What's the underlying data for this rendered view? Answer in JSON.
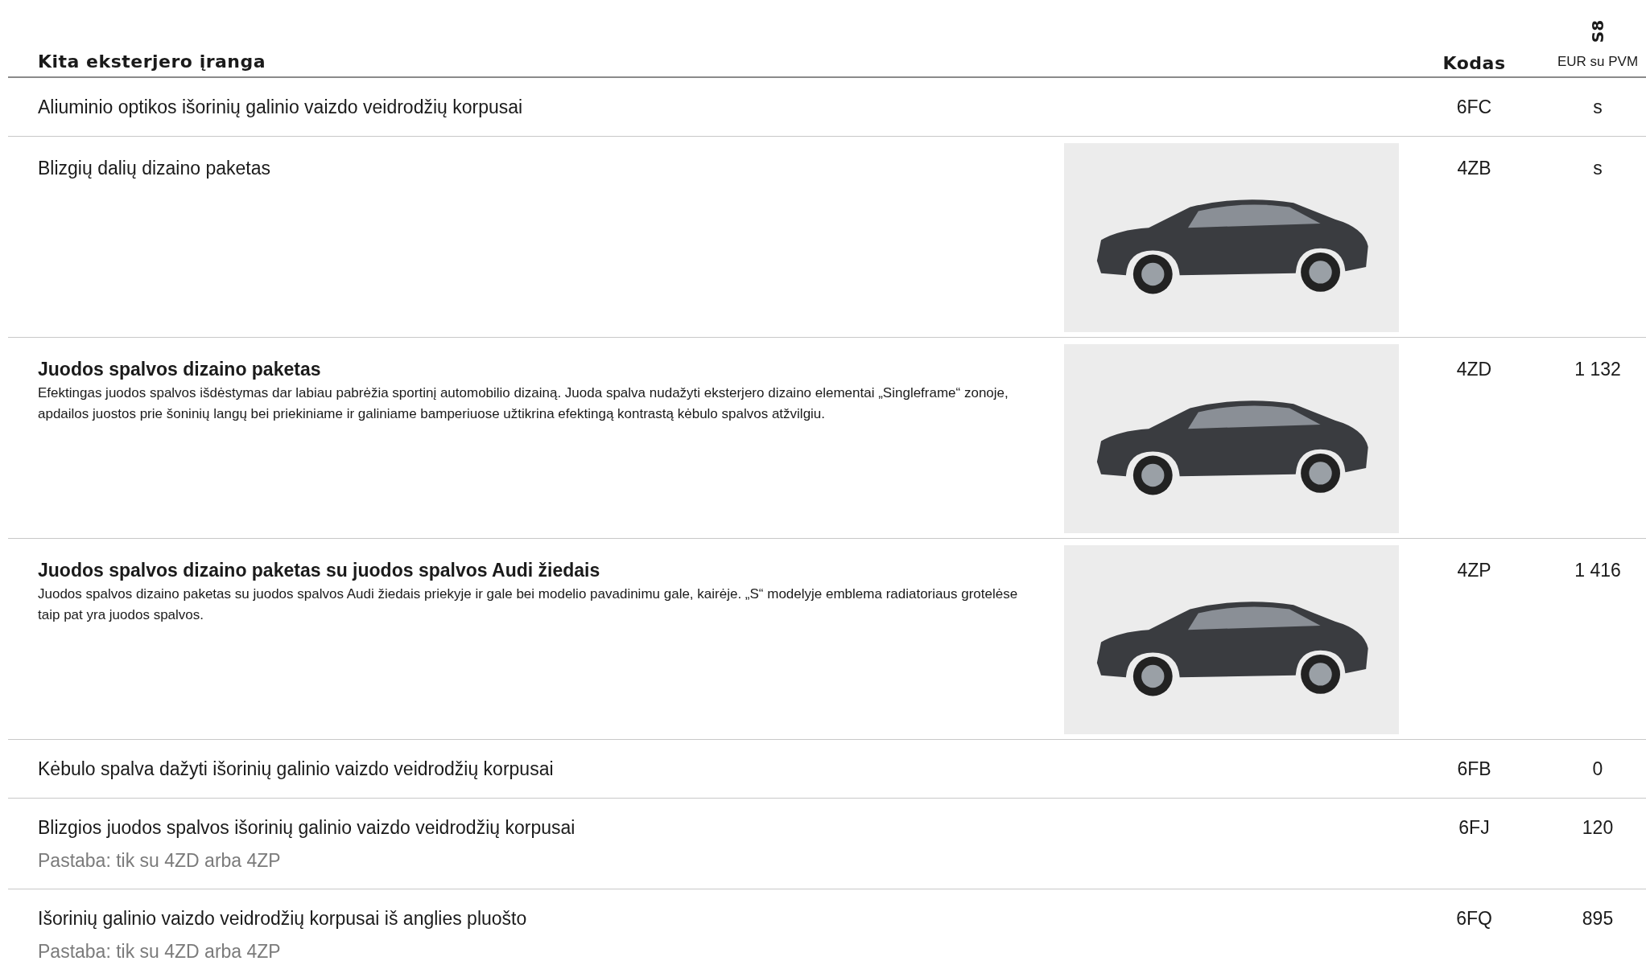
{
  "header": {
    "section_title": "Kita eksterjero įranga",
    "code_heading": "Kodas",
    "model": "S8",
    "price_heading": "EUR su PVM"
  },
  "rows": [
    {
      "kind": "plain",
      "title": "Aliuminio optikos išorinių galinio vaizdo veidrodžių korpusai",
      "code": "6FC",
      "price": "s"
    },
    {
      "kind": "featured",
      "title": "Blizgių dalių dizaino paketas",
      "bold": false,
      "image": true,
      "code": "4ZB",
      "price": "s"
    },
    {
      "kind": "featured",
      "title": "Juodos spalvos dizaino paketas",
      "bold": true,
      "description": "Efektingas juodos spalvos išdėstymas dar labiau pabrėžia sportinį automobilio dizainą. Juoda spalva nudažyti eksterjero dizaino elementai „Singleframe“ zonoje, apdailos juostos prie šoninių langų bei priekiniame ir galiniame bamperiuose užtikrina efektingą kontrastą kėbulo spalvos atžvilgiu.",
      "image": true,
      "code": "4ZD",
      "price": "1 132"
    },
    {
      "kind": "featured",
      "title": "Juodos spalvos dizaino paketas su juodos spalvos Audi žiedais",
      "bold": true,
      "description": "Juodos spalvos dizaino paketas su juodos spalvos Audi žiedais priekyje ir gale bei modelio pavadinimu gale, kairėje. „S“ modelyje emblema radiatoriaus grotelėse taip pat yra juodos spalvos.",
      "image": true,
      "code": "4ZP",
      "price": "1 416"
    },
    {
      "kind": "plain",
      "title": "Kėbulo spalva dažyti išorinių galinio vaizdo veidrodžių korpusai",
      "code": "6FB",
      "price": "0"
    },
    {
      "kind": "plain",
      "title": "Blizgios juodos spalvos išorinių galinio vaizdo veidrodžių korpusai",
      "note": "Pastaba: tik su 4ZD arba 4ZP",
      "code": "6FJ",
      "price": "120"
    },
    {
      "kind": "plain",
      "title": "Išorinių galinio vaizdo veidrodžių korpusai iš anglies pluošto",
      "note": "Pastaba: tik su 4ZD arba 4ZP",
      "code": "6FQ",
      "price": "895"
    }
  ]
}
